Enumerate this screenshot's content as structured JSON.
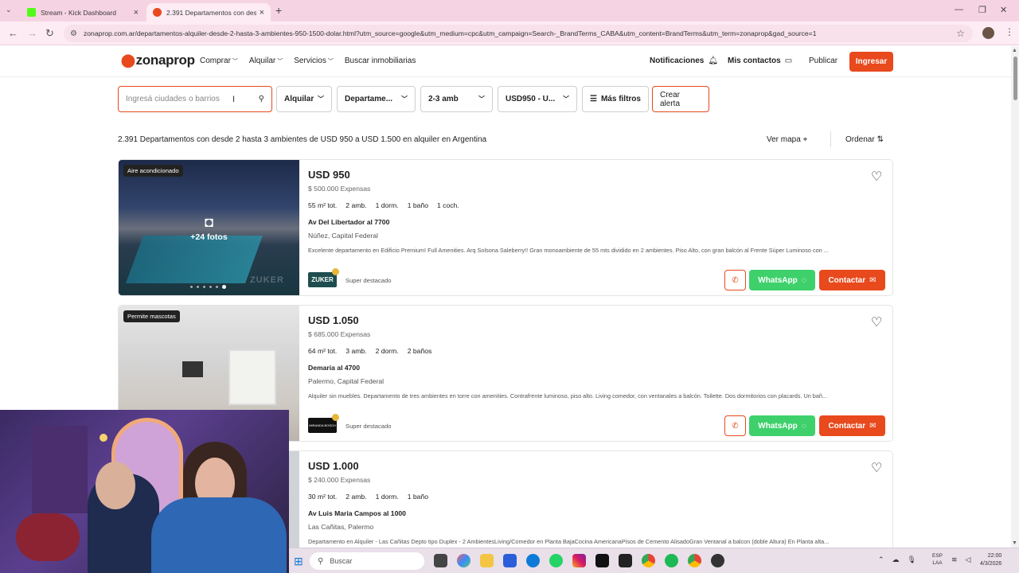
{
  "browser": {
    "tabs": [
      {
        "title": "Stream - Kick Dashboard",
        "active": false
      },
      {
        "title": "2.391 Departamentos con desd",
        "active": true
      }
    ],
    "url": "zonaprop.com.ar/departamentos-alquiler-desde-2-hasta-3-ambientes-950-1500-dolar.html?utm_source=google&utm_medium=cpc&utm_campaign=Search-_BrandTerms_CABA&utm_content=BrandTerms&utm_term=zonaprop&gad_source=1"
  },
  "header": {
    "logo": "zonaprop",
    "nav": [
      "Comprar",
      "Alquilar",
      "Servicios",
      "Buscar inmobiliarias"
    ],
    "notifications": "Notificaciones",
    "contacts": "Mis contactos",
    "publish": "Publicar",
    "login": "Ingresar"
  },
  "filters": {
    "search_placeholder": "Ingresá ciudades o barrios",
    "operation": "Alquilar",
    "type": "Departame...",
    "rooms": "2-3 amb",
    "price": "USD950 - U...",
    "more": "Más filtros",
    "alert": "Crear alerta"
  },
  "results": {
    "title": "2.391 Departamentos con desde 2 hasta 3 ambientes de USD 950 a USD 1.500 en alquiler en Argentina",
    "map": "Ver mapa",
    "sort": "Ordenar"
  },
  "listings": [
    {
      "badge": "Aire acondicionado",
      "photos": "+24 fotos",
      "price": "USD 950",
      "expensas": "$ 500.000 Expensas",
      "features": [
        "55 m² tot.",
        "2 amb.",
        "1 dorm.",
        "1 baño",
        "1 coch."
      ],
      "address": "Av Del Libertador al 7700",
      "location": "Núñez, Capital Federal",
      "description": "Excelente departamento en Edificio Premium! Full Amenities. Arq Solsona Saleberry!! Gran monoambiente de 55 mts dividido en 2 ambientes. Piso Alto, con gran balcón al Frente Súper Luminoso con ...",
      "agency": "ZUKER",
      "tier": "Super destacado",
      "whatsapp": "WhatsApp",
      "contact": "Contactar"
    },
    {
      "badge": "Permite mascotas",
      "price": "USD 1.050",
      "expensas": "$ 685.000 Expensas",
      "features": [
        "64 m² tot.",
        "3 amb.",
        "2 dorm.",
        "2 baños"
      ],
      "address": "Demaria al 4700",
      "location": "Palermo, Capital Federal",
      "description": "Alquiler sin muebles. Departamento de tres ambientes en torre con amenities. Contrafrente luminoso, piso alto. Living comedor, con ventanales a balcón. Toilette. Dos dormitorios con placards. Un bañ...",
      "agency": "MIRANDA BOSCH",
      "tier": "Super destacado",
      "whatsapp": "WhatsApp",
      "contact": "Contactar"
    },
    {
      "price": "USD 1.000",
      "expensas": "$ 240.000 Expensas",
      "features": [
        "30 m² tot.",
        "2 amb.",
        "1 dorm.",
        "1 baño"
      ],
      "address": "Av Luis Maria Campos al 1000",
      "location": "Las Cañitas, Palermo",
      "description": "Departamento en Alquiler - Las Cañitas Depto tipo Duplex - 2 AmbientesLiving/Comedor en Planta BajaCocina AmericanaPisos de Cemento AlisadoGran Ventanal a balcon (doble Altura) En Planta alta..."
    }
  ],
  "taskbar": {
    "search": "Buscar",
    "lang_line1": "ESP",
    "lang_line2": "LAA",
    "time": "22:00",
    "date": "4/3/2026"
  },
  "colors": {
    "brand": "#e8491d",
    "whatsapp": "#3ed16b"
  }
}
